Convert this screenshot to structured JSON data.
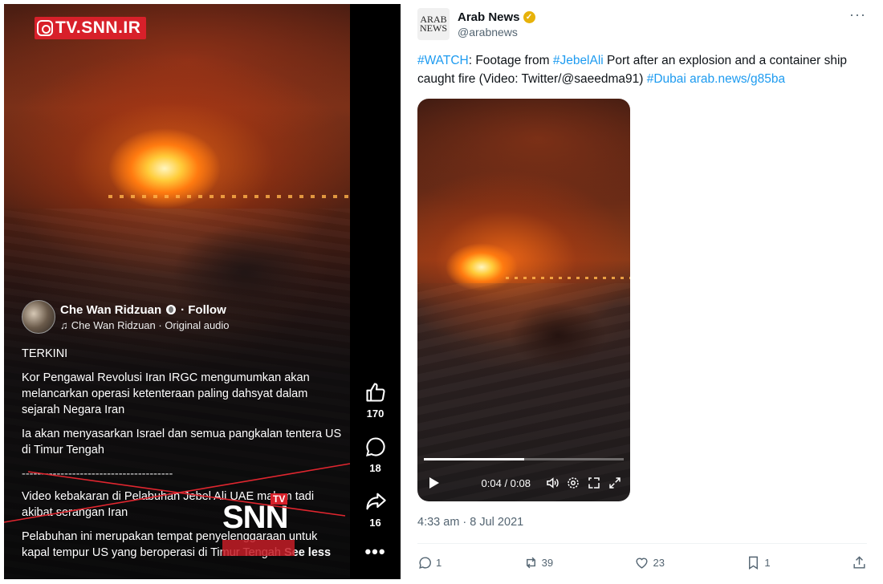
{
  "reel": {
    "watermark": "TV.SNN.IR",
    "author_name": "Che Wan Ridzuan",
    "follow_label": "· Follow",
    "audio_label": "Che Wan Ridzuan · Original audio",
    "caption": {
      "p1": "TERKINI",
      "p2": "Kor Pengawal Revolusi Iran IRGC mengumumkan akan melancarkan operasi ketenteraan paling dahsyat dalam sejarah Negara Iran",
      "p3": "Ia akan menyasarkan Israel dan semua pangkalan tentera US di Timur Tengah",
      "divider": "---------------------------------------",
      "p4": "Video kebakaran di Pelabuhan Jebel Ali UAE malam tadi akibat serangan Iran",
      "p5": "Pelabuhan ini merupakan tempat penyelenggaraan untuk kapal tempur US yang beroperasi di Timur Tengah",
      "see_less": "See less"
    },
    "overlay_mark": "SNN",
    "overlay_tag": "TV",
    "likes": "170",
    "comments": "18",
    "shares": "16",
    "more": "•••",
    "icons": [
      "instagram-icon",
      "globe-icon",
      "music-note-icon",
      "thumbs-up-icon",
      "comment-icon",
      "share-icon",
      "more-icon"
    ]
  },
  "tweet": {
    "avatar_line1": "ARAB",
    "avatar_line2": "NEWS",
    "name": "Arab News",
    "handle": "@arabnews",
    "more": "···",
    "text": {
      "hashtag_watch": "#WATCH",
      "t1": ": Footage from ",
      "hashtag_jebelali": "#JebelAli",
      "t2": " Port after an explosion and a container ship caught fire (Video: Twitter/@saeedma91) ",
      "hashtag_dubai": "#Dubai",
      "link": "arab.news/g85ba"
    },
    "video": {
      "time": "0:04 / 0:08",
      "progress": 0.5
    },
    "date": "4:33 am · 8 Jul 2021",
    "replies": "1",
    "retweets": "39",
    "likes": "23",
    "bookmarks": "1",
    "colors": {
      "link": "#1d9bf0",
      "verified": "#e7b20a",
      "muted": "#536471"
    }
  }
}
